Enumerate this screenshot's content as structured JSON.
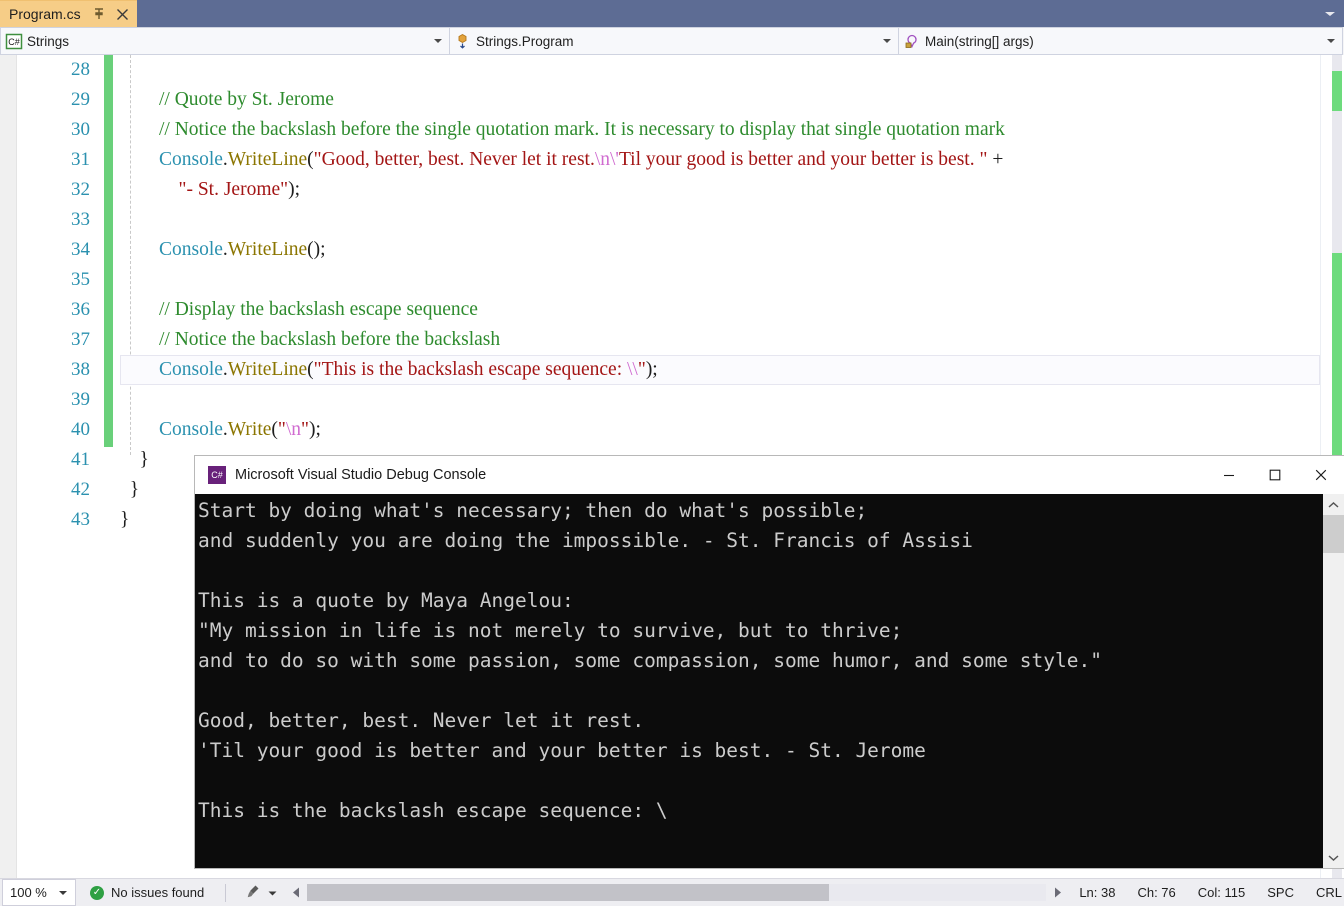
{
  "window": {
    "tab": {
      "title": "Program.cs",
      "pin_icon": "pin-icon",
      "close_icon": "close-icon"
    },
    "tabstrip_overflow_icon": "chevron-down-icon"
  },
  "navbar": {
    "project": {
      "icon": "csharp-project-icon",
      "label": "Strings"
    },
    "class": {
      "icon": "class-icon",
      "label": "Strings.Program"
    },
    "member": {
      "icon": "method-private-icon",
      "label": "Main(string[] args)"
    }
  },
  "editor": {
    "first_line_number": 28,
    "lines": [
      {
        "num": "28",
        "tokens": []
      },
      {
        "num": "29",
        "tokens": [
          {
            "t": "        ",
            "c": "c-punct"
          },
          {
            "t": "// Quote by St. Jerome",
            "c": "c-comment"
          }
        ]
      },
      {
        "num": "30",
        "tokens": [
          {
            "t": "        ",
            "c": "c-punct"
          },
          {
            "t": "// Notice the backslash before the single quotation mark. It is necessary to display that single quotation mark",
            "c": "c-comment"
          }
        ]
      },
      {
        "num": "31",
        "tokens": [
          {
            "t": "        ",
            "c": "c-punct"
          },
          {
            "t": "Console",
            "c": "c-type"
          },
          {
            "t": ".",
            "c": "c-punct"
          },
          {
            "t": "WriteLine",
            "c": "c-method"
          },
          {
            "t": "(",
            "c": "c-punct"
          },
          {
            "t": "\"Good, better, best. Never let it rest.",
            "c": "c-string"
          },
          {
            "t": "\\n",
            "c": "c-esc"
          },
          {
            "t": "\\'",
            "c": "c-esc"
          },
          {
            "t": "Til your good is better and your better is best. \"",
            "c": "c-string"
          },
          {
            "t": " + ",
            "c": "c-punct"
          }
        ]
      },
      {
        "num": "32",
        "tokens": [
          {
            "t": "            ",
            "c": "c-punct"
          },
          {
            "t": "\"- St. Jerome\"",
            "c": "c-string"
          },
          {
            "t": ");",
            "c": "c-punct"
          }
        ]
      },
      {
        "num": "33",
        "tokens": []
      },
      {
        "num": "34",
        "tokens": [
          {
            "t": "        ",
            "c": "c-punct"
          },
          {
            "t": "Console",
            "c": "c-type"
          },
          {
            "t": ".",
            "c": "c-punct"
          },
          {
            "t": "WriteLine",
            "c": "c-method"
          },
          {
            "t": "();",
            "c": "c-punct"
          }
        ]
      },
      {
        "num": "35",
        "tokens": []
      },
      {
        "num": "36",
        "tokens": [
          {
            "t": "        ",
            "c": "c-punct"
          },
          {
            "t": "// Display the backslash escape sequence",
            "c": "c-comment"
          }
        ]
      },
      {
        "num": "37",
        "tokens": [
          {
            "t": "        ",
            "c": "c-punct"
          },
          {
            "t": "// Notice the backslash before the backslash",
            "c": "c-comment"
          }
        ]
      },
      {
        "num": "38",
        "current": true,
        "tokens": [
          {
            "t": "        ",
            "c": "c-punct"
          },
          {
            "t": "Console",
            "c": "c-type"
          },
          {
            "t": ".",
            "c": "c-punct"
          },
          {
            "t": "WriteLine",
            "c": "c-method"
          },
          {
            "t": "(",
            "c": "c-punct"
          },
          {
            "t": "\"This is the backslash escape sequence: ",
            "c": "c-string"
          },
          {
            "t": "\\\\",
            "c": "c-esc"
          },
          {
            "t": "\"",
            "c": "c-string"
          },
          {
            "t": ");",
            "c": "c-punct"
          }
        ]
      },
      {
        "num": "39",
        "tokens": []
      },
      {
        "num": "40",
        "tokens": [
          {
            "t": "        ",
            "c": "c-punct"
          },
          {
            "t": "Console",
            "c": "c-type"
          },
          {
            "t": ".",
            "c": "c-punct"
          },
          {
            "t": "Write",
            "c": "c-method"
          },
          {
            "t": "(",
            "c": "c-punct"
          },
          {
            "t": "\"",
            "c": "c-string"
          },
          {
            "t": "\\n",
            "c": "c-esc"
          },
          {
            "t": "\"",
            "c": "c-string"
          },
          {
            "t": ");",
            "c": "c-punct"
          }
        ]
      },
      {
        "num": "41",
        "tokens": [
          {
            "t": "    }",
            "c": "c-brace"
          }
        ]
      },
      {
        "num": "42",
        "tokens": [
          {
            "t": "  }",
            "c": "c-brace"
          }
        ]
      },
      {
        "num": "43",
        "tokens": [
          {
            "t": "}",
            "c": "c-brace"
          }
        ]
      }
    ]
  },
  "console": {
    "title": "Microsoft Visual Studio Debug Console",
    "icon": "vs-console-icon",
    "minimize_icon": "minimize-icon",
    "maximize_icon": "maximize-icon",
    "close_icon": "close-icon",
    "scroll_up_icon": "chevron-up-icon",
    "scroll_down_icon": "chevron-down-icon",
    "output": "Start by doing what's necessary; then do what's possible;\nand suddenly you are doing the impossible. - St. Francis of Assisi\n\nThis is a quote by Maya Angelou:\n\"My mission in life is not merely to survive, but to thrive;\nand to do so with some passion, some compassion, some humor, and some style.\"\n\nGood, better, best. Never let it rest.\n'Til your good is better and your better is best. - St. Jerome\n\nThis is the backslash escape sequence: \\"
  },
  "statusbar": {
    "zoom": "100 %",
    "zoom_arrow_icon": "chevron-down-icon",
    "status_icon": "check-circle-icon",
    "status_text": "No issues found",
    "brush_icon": "brush-icon",
    "brush_arrow_icon": "chevron-down-icon",
    "scroll_left_icon": "triangle-left-icon",
    "scroll_right_icon": "triangle-right-icon",
    "line": "Ln: 38",
    "char": "Ch: 76",
    "col": "Col: 115",
    "spaces": "SPC",
    "eol": "CRL"
  },
  "colors": {
    "tab_active": "#f6cd87",
    "tabstrip_bg": "#5d6c94",
    "comment": "#2e8b2e",
    "type": "#2b91af",
    "method": "#8b7500",
    "string": "#a31515",
    "escape": "#d06bd0",
    "linenumber": "#2b91af",
    "changebar": "#69d07a",
    "console_bg": "#0c0c0c",
    "console_fg": "#cccccc",
    "status_ok": "#2ea043"
  }
}
